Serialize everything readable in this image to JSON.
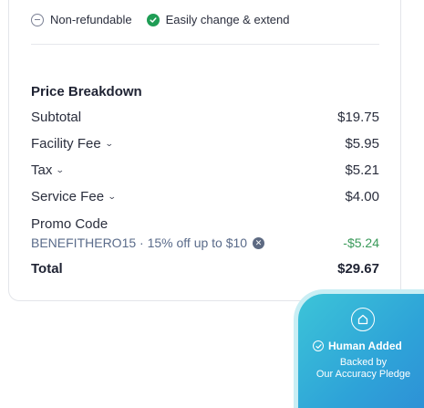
{
  "badges": {
    "non_refundable": "Non-refundable",
    "easily_change": "Easily change & extend"
  },
  "breakdown": {
    "title": "Price Breakdown",
    "rows": [
      {
        "label": "Subtotal",
        "value": "$19.75",
        "expandable": false
      },
      {
        "label": "Facility Fee",
        "value": "$5.95",
        "expandable": true
      },
      {
        "label": "Tax",
        "value": "$5.21",
        "expandable": true
      },
      {
        "label": "Service Fee",
        "value": "$4.00",
        "expandable": true
      }
    ],
    "promo": {
      "label": "Promo Code",
      "code": "BENEFITHERO15 · 15% off up to $10",
      "discount": "-$5.24"
    },
    "total": {
      "label": "Total",
      "value": "$29.67"
    }
  },
  "pledge": {
    "heading": "Human Added",
    "line1": "Backed by",
    "line2": "Our Accuracy Pledge"
  },
  "colors": {
    "accent_green": "#1f9d55",
    "discount_green": "#3a9a5a",
    "promo_text": "#5a6b8a",
    "pledge_gradient_start": "#3cc4d8",
    "pledge_gradient_end": "#2d8fd6"
  }
}
